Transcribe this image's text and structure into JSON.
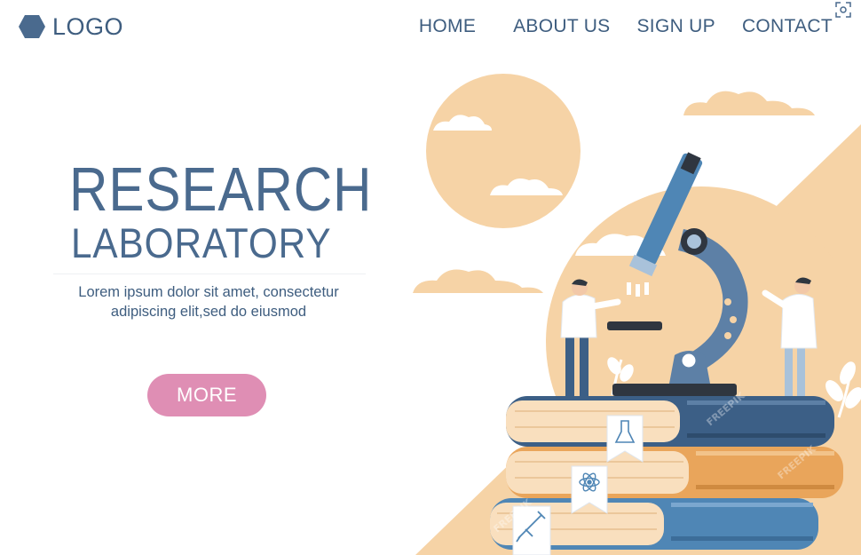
{
  "header": {
    "logo_text": "LOGO",
    "logo_icon": "hexagon-icon",
    "corner_icon": "scan-icon",
    "nav": [
      {
        "label": "HOME"
      },
      {
        "label": "ABOUT US"
      },
      {
        "label": "SIGN UP"
      },
      {
        "label": "CONTACT"
      }
    ]
  },
  "hero": {
    "title": "RESEARCH",
    "subtitle": "LABORATORY",
    "text_line1": "Lorem ipsum dolor sit amet, consectetur",
    "text_line2": "adipiscing elit,sed do eiusmod",
    "button_label": "MORE"
  },
  "illustration": {
    "watermark": "FREEPIK",
    "bookmark_icons": [
      "flask-icon",
      "atom-icon",
      "syringe-icon"
    ]
  },
  "colors": {
    "primary": "#3e5d7f",
    "accent": "#df8eb4",
    "peach": "#f6d3a6",
    "orange": "#e9a55b",
    "blue": "#4f86b5",
    "dark_blue": "#3c5f86"
  }
}
